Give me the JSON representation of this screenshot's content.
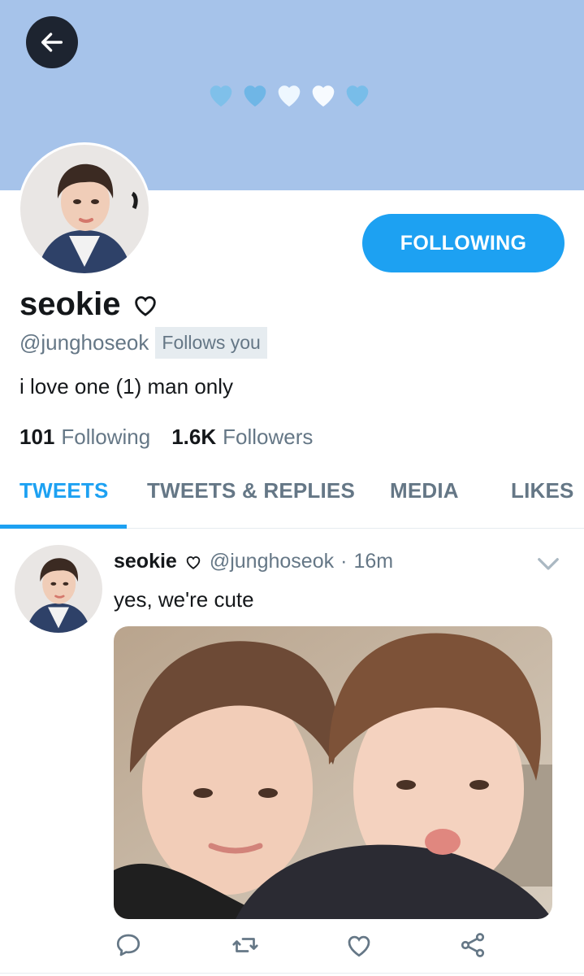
{
  "header": {
    "back_icon": "arrow-left-icon",
    "banner_color": "#a6c3ea",
    "banner_decoration": [
      "blue-heart-icon",
      "blue-heart-icon",
      "white-heart-icon",
      "white-heart-icon",
      "blue-heart-icon"
    ]
  },
  "profile": {
    "display_name": "seokie",
    "name_icon": "heart-outline-icon",
    "handle": "@junghoseok",
    "follows_you": "Follows you",
    "bio": "i love one (1) man only",
    "following_count": "101",
    "following_label": "Following",
    "followers_count": "1.6K",
    "followers_label": "Followers",
    "follow_button": "FOLLOWING"
  },
  "tabs": [
    {
      "label": "TWEETS",
      "active": true
    },
    {
      "label": "TWEETS & REPLIES",
      "active": false
    },
    {
      "label": "MEDIA",
      "active": false
    },
    {
      "label": "LIKES",
      "active": false
    }
  ],
  "tweet": {
    "name": "seokie",
    "handle": "@junghoseok",
    "separator": "·",
    "time": "16m",
    "text": "yes, we're cute",
    "actions": [
      "reply-icon",
      "retweet-icon",
      "like-icon",
      "share-icon"
    ]
  },
  "colors": {
    "accent": "#1da1f2",
    "muted": "#657786",
    "text": "#14171a"
  }
}
